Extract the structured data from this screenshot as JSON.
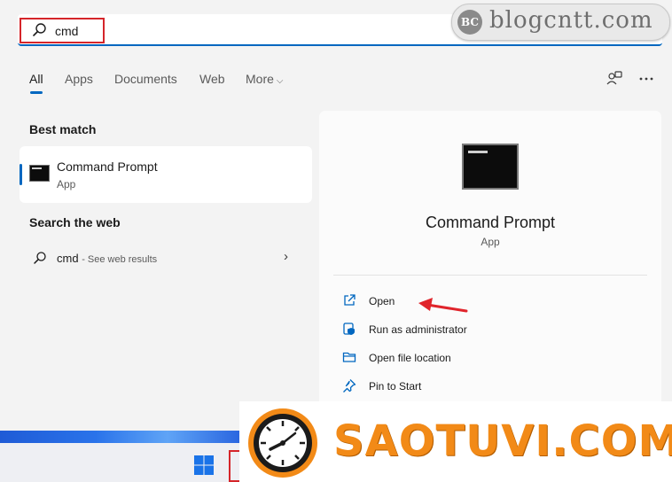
{
  "search": {
    "query": "cmd"
  },
  "watermark": {
    "logo": "BC",
    "text": "blogcntt.com"
  },
  "tabs": [
    {
      "label": "All",
      "active": true
    },
    {
      "label": "Apps"
    },
    {
      "label": "Documents"
    },
    {
      "label": "Web"
    },
    {
      "label": "More"
    }
  ],
  "toolbar_icons": [
    "account-switch-icon",
    "more-options-icon"
  ],
  "best_match": {
    "heading": "Best match",
    "app_name": "Command Prompt",
    "app_type": "App"
  },
  "search_web": {
    "heading": "Search the web",
    "query": "cmd",
    "suffix": "- See web results"
  },
  "details": {
    "app_name": "Command Prompt",
    "app_type": "App",
    "actions": [
      {
        "label": "Open",
        "icon": "open-icon"
      },
      {
        "label": "Run as administrator",
        "icon": "shield-icon"
      },
      {
        "label": "Open file location",
        "icon": "folder-icon"
      },
      {
        "label": "Pin to Start",
        "icon": "pin-icon"
      }
    ]
  },
  "overlay_logo": {
    "text": "SAOTUVI.COM"
  },
  "colors": {
    "accent": "#0067c0",
    "highlight_red": "#d5252a",
    "logo_orange": "#f28a17"
  }
}
